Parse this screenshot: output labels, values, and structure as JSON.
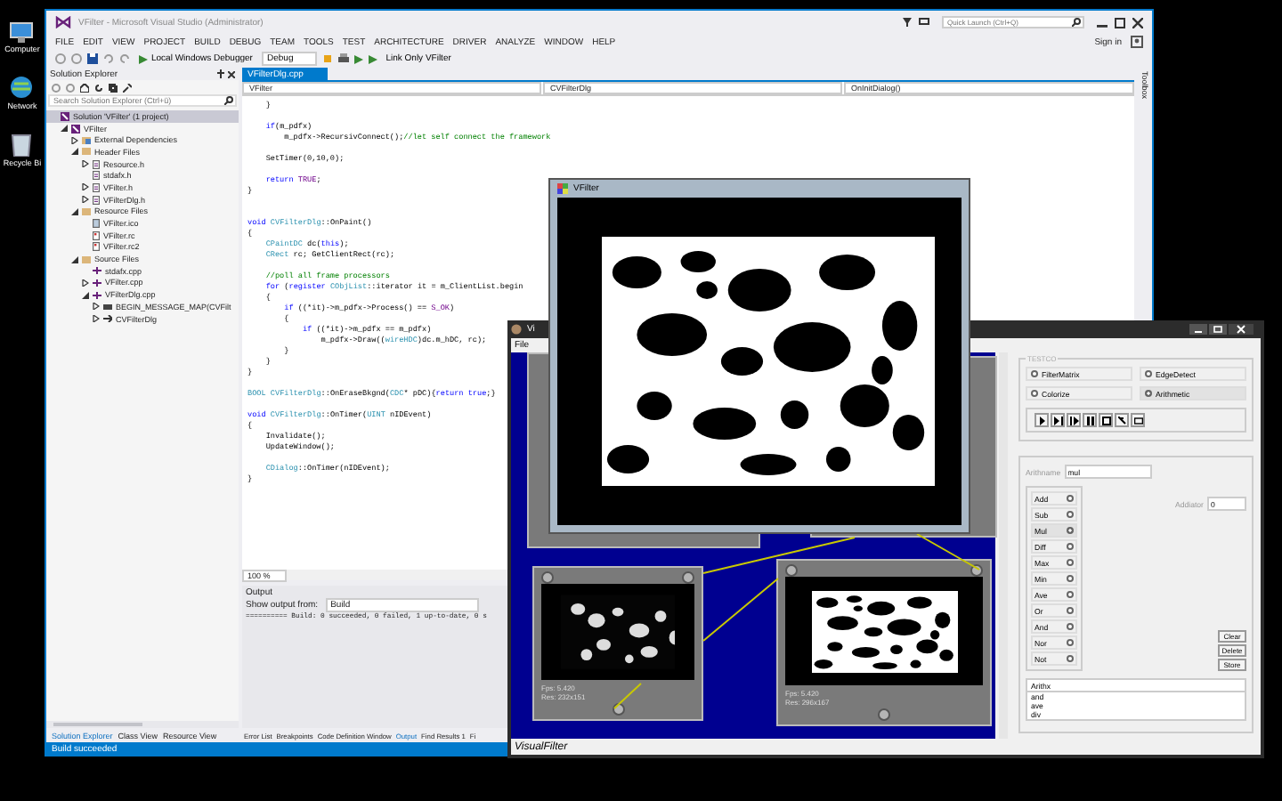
{
  "desktop_icons": [
    {
      "kind": "computer",
      "label": "Computer"
    },
    {
      "kind": "network",
      "label": "Network"
    },
    {
      "kind": "recycle_bin",
      "label": "Recycle Bi"
    }
  ],
  "vs": {
    "title": "VFilter - Microsoft Visual Studio (Administrator)",
    "quick_launch": {
      "placeholder": "Quick Launch (Ctrl+Q)"
    },
    "menu": [
      "FILE",
      "EDIT",
      "VIEW",
      "PROJECT",
      "BUILD",
      "DEBUG",
      "TEAM",
      "TOOLS",
      "TEST",
      "ARCHITECTURE",
      "DRIVER",
      "ANALYZE",
      "WINDOW",
      "HELP"
    ],
    "sign_in": "Sign in",
    "toolbar": {
      "debugger": "Local Windows Debugger",
      "configuration": "Debug",
      "link_only": "Link Only VFilter"
    },
    "solution_explorer": {
      "title": "Solution Explorer",
      "search": {
        "placeholder": "Search Solution Explorer (Ctrl+ü)"
      },
      "tree": [
        {
          "label": "Solution 'VFilter' (1 project)",
          "kind": "solution",
          "selected": true,
          "children": [
            {
              "label": "VFilter",
              "kind": "project",
              "selected": false,
              "expanded": true,
              "children": [
                {
                  "label": "External Dependencies",
                  "kind": "dependencies",
                  "selected": false,
                  "expanded": false
                },
                {
                  "label": "Header Files",
                  "kind": "folder",
                  "selected": false,
                  "expanded": true,
                  "children": [
                    {
                      "label": "Resource.h",
                      "kind": "header",
                      "selected": false,
                      "expanded": false
                    },
                    {
                      "label": "stdafx.h",
                      "kind": "header",
                      "selected": false
                    },
                    {
                      "label": "VFilter.h",
                      "kind": "header",
                      "selected": false,
                      "expanded": false
                    },
                    {
                      "label": "VFilterDlg.h",
                      "kind": "header",
                      "selected": false,
                      "expanded": false
                    }
                  ]
                },
                {
                  "label": "Resource Files",
                  "kind": "folder",
                  "selected": false,
                  "expanded": true,
                  "children": [
                    {
                      "label": "VFilter.ico",
                      "kind": "image",
                      "selected": false
                    },
                    {
                      "label": "VFilter.rc",
                      "kind": "resource",
                      "selected": false
                    },
                    {
                      "label": "VFilter.rc2",
                      "kind": "resource",
                      "selected": false
                    }
                  ]
                },
                {
                  "label": "Source Files",
                  "kind": "folder",
                  "selected": false,
                  "expanded": true,
                  "children": [
                    {
                      "label": "stdafx.cpp",
                      "kind": "source",
                      "selected": false
                    },
                    {
                      "label": "VFilter.cpp",
                      "kind": "source",
                      "selected": false,
                      "expanded": false
                    },
                    {
                      "label": "VFilterDlg.cpp",
                      "kind": "source",
                      "selected": false,
                      "expanded": true,
                      "children": [
                        {
                          "label": "BEGIN_MESSAGE_MAP(CVFilt",
                          "kind": "macro",
                          "selected": false,
                          "expanded": false
                        },
                        {
                          "label": "CVFilterDlg",
                          "kind": "class",
                          "selected": false,
                          "expanded": false
                        }
                      ]
                    }
                  ]
                }
              ]
            }
          ]
        }
      ]
    },
    "document_tab": {
      "label": "VFilterDlg.cpp",
      "selected": true
    },
    "nav": [
      "VFilter",
      "CVFilterDlg",
      "OnInitDialog()"
    ],
    "code": [
      {
        "segments": [
          {
            "text": "    }",
            "kind": "plain"
          }
        ]
      },
      {
        "blank_before": true,
        "segments": [
          {
            "text": "    if",
            "kind": "keyword"
          },
          {
            "text": "(m_pdfx)",
            "kind": "plain"
          }
        ]
      },
      {
        "segments": [
          {
            "text": "        m_pdfx->RecursivConnect();",
            "kind": "plain"
          },
          {
            "text": "//let self connect the framework",
            "kind": "comment"
          }
        ]
      },
      {
        "blank_before": true,
        "segments": [
          {
            "text": "    SetTimer(0,10,0);",
            "kind": "plain"
          }
        ]
      },
      {
        "blank_before": true,
        "segments": [
          {
            "text": "    return",
            "kind": "keyword"
          },
          {
            "text": " TRUE",
            "kind": "macro"
          },
          {
            "text": ";",
            "kind": "plain"
          }
        ]
      },
      {
        "blank_after": true,
        "segments": [
          {
            "text": "}",
            "kind": "plain"
          }
        ]
      },
      {
        "blank_before": true,
        "segments": [
          {
            "text": "void",
            "kind": "keyword"
          },
          {
            "text": " CVFilterDlg",
            "kind": "type"
          },
          {
            "text": "::OnPaint()",
            "kind": "plain"
          }
        ]
      },
      {
        "segments": [
          {
            "text": "{",
            "kind": "plain"
          }
        ]
      },
      {
        "segments": [
          {
            "text": "    CPaintDC",
            "kind": "type"
          },
          {
            "text": " dc(",
            "kind": "plain"
          },
          {
            "text": "this",
            "kind": "keyword"
          },
          {
            "text": ");",
            "kind": "plain"
          }
        ]
      },
      {
        "segments": [
          {
            "text": "    CRect",
            "kind": "type"
          },
          {
            "text": " rc; GetClientRect(rc);",
            "kind": "plain"
          }
        ]
      },
      {
        "blank_before": true,
        "segments": [
          {
            "text": "    //poll all frame processors",
            "kind": "comment"
          }
        ]
      },
      {
        "segments": [
          {
            "text": "    for",
            "kind": "keyword"
          },
          {
            "text": " (",
            "kind": "plain"
          },
          {
            "text": "register",
            "kind": "keyword"
          },
          {
            "text": " CObjList",
            "kind": "type"
          },
          {
            "text": "::iterator it = m_ClientList.begin",
            "kind": "plain"
          }
        ]
      },
      {
        "segments": [
          {
            "text": "    {",
            "kind": "plain"
          }
        ]
      },
      {
        "segments": [
          {
            "text": "        if",
            "kind": "keyword"
          },
          {
            "text": " ((*it)->m_pdfx->Process() == ",
            "kind": "plain"
          },
          {
            "text": "S_OK",
            "kind": "macro"
          },
          {
            "text": ")",
            "kind": "plain"
          }
        ]
      },
      {
        "segments": [
          {
            "text": "        {",
            "kind": "plain"
          }
        ]
      },
      {
        "segments": [
          {
            "text": "            if",
            "kind": "keyword"
          },
          {
            "text": " ((*it)->m_pdfx == m_pdfx)",
            "kind": "plain"
          }
        ]
      },
      {
        "segments": [
          {
            "text": "                m_pdfx->Draw((",
            "kind": "plain"
          },
          {
            "text": "wireHDC",
            "kind": "type"
          },
          {
            "text": ")dc.m_hDC, rc);",
            "kind": "plain"
          }
        ]
      },
      {
        "segments": [
          {
            "text": "        }",
            "kind": "plain"
          }
        ]
      },
      {
        "segments": [
          {
            "text": "    }",
            "kind": "plain"
          }
        ]
      },
      {
        "segments": [
          {
            "text": "}",
            "kind": "plain"
          }
        ]
      },
      {
        "blank_before": true,
        "segments": [
          {
            "text": "BOOL",
            "kind": "type"
          },
          {
            "text": " CVFilterDlg",
            "kind": "type"
          },
          {
            "text": "::OnEraseBkgnd(",
            "kind": "plain"
          },
          {
            "text": "CDC",
            "kind": "type"
          },
          {
            "text": "* pDC){",
            "kind": "plain"
          },
          {
            "text": "return true",
            "kind": "keyword"
          },
          {
            "text": ";}",
            "kind": "plain"
          }
        ]
      },
      {
        "blank_before": true,
        "segments": [
          {
            "text": "void",
            "kind": "keyword"
          },
          {
            "text": " CVFilterDlg",
            "kind": "type"
          },
          {
            "text": "::OnTimer(",
            "kind": "plain"
          },
          {
            "text": "UINT",
            "kind": "type"
          },
          {
            "text": " nIDEvent)",
            "kind": "plain"
          }
        ]
      },
      {
        "segments": [
          {
            "text": "{",
            "kind": "plain"
          }
        ]
      },
      {
        "segments": [
          {
            "text": "    Invalidate();",
            "kind": "plain"
          }
        ]
      },
      {
        "segments": [
          {
            "text": "    UpdateWindow();",
            "kind": "plain"
          }
        ]
      },
      {
        "blank_before": true,
        "segments": [
          {
            "text": "    CDialog",
            "kind": "type"
          },
          {
            "text": "::OnTimer(nIDEvent);",
            "kind": "plain"
          }
        ]
      },
      {
        "segments": [
          {
            "text": "}",
            "kind": "plain"
          }
        ]
      }
    ],
    "zoom": "100 %",
    "output": {
      "title": "Output",
      "source_label": "Show output from:",
      "source": "Build",
      "text": "========== Build: 0 succeeded, 0 failed, 1 up-to-date, 0 s"
    },
    "left_tabs": [
      {
        "label": "Solution Explorer",
        "selected": true
      },
      {
        "label": "Class View",
        "selected": false
      },
      {
        "label": "Resource View",
        "selected": false
      }
    ],
    "bottom_tabs": [
      {
        "label": "Error List",
        "selected": false
      },
      {
        "label": "Breakpoints",
        "selected": false
      },
      {
        "label": "Code Definition Window",
        "selected": false
      },
      {
        "label": "Output",
        "selected": true
      },
      {
        "label": "Find Results 1",
        "selected": false
      },
      {
        "label": "Fi",
        "selected": false
      }
    ],
    "status": "Build succeeded",
    "toolbox": "Toolbox"
  },
  "visual_filter": {
    "title": "Vi",
    "menu": [
      "File"
    ],
    "nodes": [
      {
        "kind": "covered"
      },
      {
        "kind": "covered"
      },
      {
        "kind": "grayscale",
        "fps": "Fps: 5.420",
        "res": "Res: 232x151"
      },
      {
        "kind": "binary",
        "fps": "Fps: 5.420",
        "res": "Res: 296x167"
      }
    ],
    "panel": {
      "group_title": "TESTCO",
      "modes": [
        {
          "label": "FilterMatrix",
          "selected": false
        },
        {
          "label": "EdgeDetect",
          "selected": false
        },
        {
          "label": "Colorize",
          "selected": false
        },
        {
          "label": "Arithmetic",
          "selected": true
        }
      ],
      "controls": [
        {
          "kind": "play"
        },
        {
          "kind": "step"
        },
        {
          "kind": "next"
        },
        {
          "kind": "pause"
        },
        {
          "kind": "stop"
        },
        {
          "kind": "pick"
        },
        {
          "kind": "window"
        }
      ],
      "arithname": {
        "label": "Arithname",
        "value": "mul"
      },
      "operations": [
        {
          "label": "Add",
          "selected": false
        },
        {
          "label": "Sub",
          "selected": false
        },
        {
          "label": "Mul",
          "selected": true
        },
        {
          "label": "Diff",
          "selected": false
        },
        {
          "label": "Max",
          "selected": false
        },
        {
          "label": "Min",
          "selected": false
        },
        {
          "label": "Ave",
          "selected": false
        },
        {
          "label": "Or",
          "selected": false
        },
        {
          "label": "And",
          "selected": false
        },
        {
          "label": "Nor",
          "selected": false
        },
        {
          "label": "Not",
          "selected": false
        }
      ],
      "addiator": {
        "label": "Addiator",
        "value": "0"
      },
      "buttons": [
        "Clear",
        "Delete",
        "Store"
      ],
      "list": {
        "header": "Arithx",
        "items": [
          "and",
          "ave",
          "div"
        ]
      }
    },
    "status": "VisualFilter"
  },
  "vfilter": {
    "title": "VFilter"
  }
}
